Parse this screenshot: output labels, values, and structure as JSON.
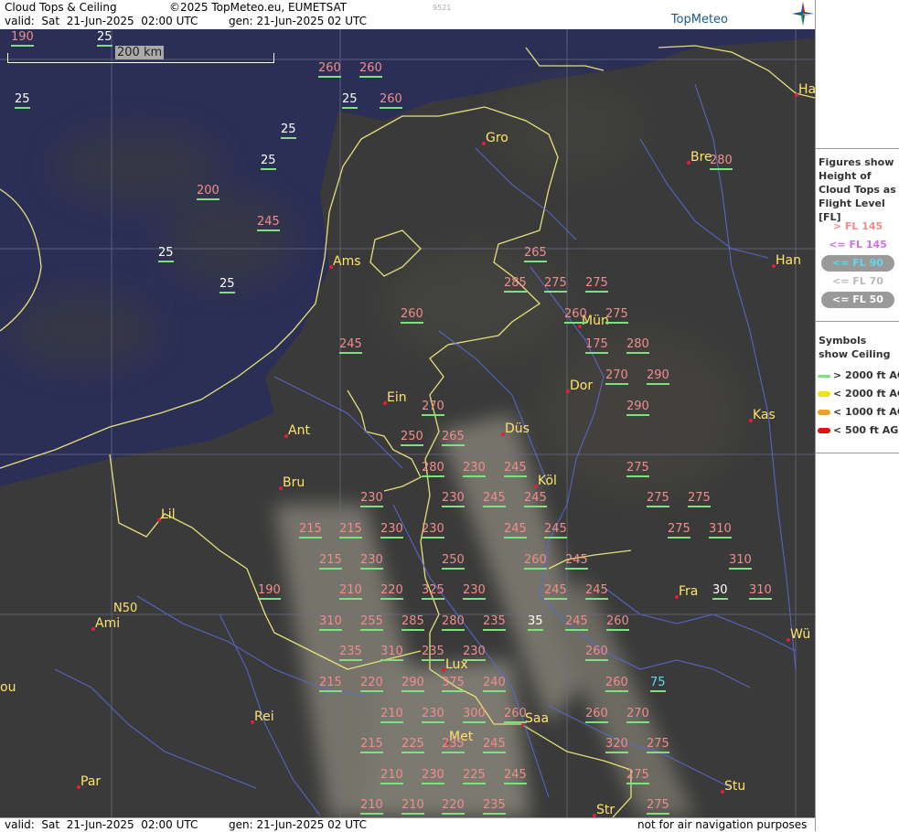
{
  "header": {
    "title": "Cloud Tops & Ceiling",
    "copyright": "©2025 TopMeteo.eu, EUMETSAT",
    "code": "9521",
    "valid": "valid:  Sat  21-Jun-2025  02:00 UTC",
    "gen": "gen: 21-Jun-2025 02 UTC",
    "logo": "TopMeteo"
  },
  "footer": {
    "valid": "valid:  Sat  21-Jun-2025  02:00 UTC",
    "gen": "gen: 21-Jun-2025 02 UTC",
    "disclaimer": "not for air navigation purposes"
  },
  "scale": "200 km",
  "latitude_label": "N50",
  "legend": {
    "title": "Figures show Height of Cloud Tops as Flight Level  [FL]",
    "levels": [
      {
        "label": "> FL 145",
        "color": "#f28c8c"
      },
      {
        "label": "<= FL 145",
        "color": "#d070e0"
      },
      {
        "label": "<= FL 90",
        "color": "#60d8f0"
      },
      {
        "label": "<= FL 70",
        "color": "#bbbbbb"
      },
      {
        "label": "<= FL 50",
        "color": "#ffffff"
      }
    ],
    "symbols_title": "Symbols show Ceiling",
    "symbols": [
      {
        "label": "> 2000 ft AGL",
        "color": "#7fe07f"
      },
      {
        "label": "< 2000 ft AGL",
        "color": "#f0e020"
      },
      {
        "label": "< 1000 ft AGL",
        "color": "#f0a020"
      },
      {
        "label": "< 500 ft AGL",
        "color": "#e01010"
      }
    ]
  },
  "cities": [
    {
      "name": "Gro"
    },
    {
      "name": "Bre"
    },
    {
      "name": "Ha"
    },
    {
      "name": "Ams"
    },
    {
      "name": "Han"
    },
    {
      "name": "Mün"
    },
    {
      "name": "Ein"
    },
    {
      "name": "Dor"
    },
    {
      "name": "Düs"
    },
    {
      "name": "Kas"
    },
    {
      "name": "Ant"
    },
    {
      "name": "Köl"
    },
    {
      "name": "Bru"
    },
    {
      "name": "Lil"
    },
    {
      "name": "Fra"
    },
    {
      "name": "Ami"
    },
    {
      "name": "Wü"
    },
    {
      "name": "Lux"
    },
    {
      "name": "ou"
    },
    {
      "name": "Rei"
    },
    {
      "name": "Saa"
    },
    {
      "name": "Met"
    },
    {
      "name": "Par"
    },
    {
      "name": "Stu"
    },
    {
      "name": "Str"
    }
  ],
  "values": [
    {
      "v": "190",
      "c": "pink"
    },
    {
      "v": "25",
      "c": "white"
    },
    {
      "v": "260",
      "c": "pink"
    },
    {
      "v": "260",
      "c": "pink"
    },
    {
      "v": "25",
      "c": "white"
    },
    {
      "v": "25",
      "c": "white"
    },
    {
      "v": "260",
      "c": "pink"
    },
    {
      "v": "25",
      "c": "white"
    },
    {
      "v": "25",
      "c": "white"
    },
    {
      "v": "280",
      "c": "pink"
    },
    {
      "v": "200",
      "c": "pink"
    },
    {
      "v": "245",
      "c": "pink"
    },
    {
      "v": "25",
      "c": "white"
    },
    {
      "v": "265",
      "c": "pink"
    },
    {
      "v": "25",
      "c": "white"
    },
    {
      "v": "285",
      "c": "pink"
    },
    {
      "v": "275",
      "c": "pink"
    },
    {
      "v": "275",
      "c": "pink"
    },
    {
      "v": "260",
      "c": "pink"
    },
    {
      "v": "260",
      "c": "pink"
    },
    {
      "v": "275",
      "c": "pink"
    },
    {
      "v": "245",
      "c": "pink"
    },
    {
      "v": "175",
      "c": "pink"
    },
    {
      "v": "280",
      "c": "pink"
    },
    {
      "v": "270",
      "c": "pink"
    },
    {
      "v": "290",
      "c": "pink"
    },
    {
      "v": "270",
      "c": "pink"
    },
    {
      "v": "290",
      "c": "pink"
    },
    {
      "v": "250",
      "c": "pink"
    },
    {
      "v": "265",
      "c": "pink"
    },
    {
      "v": "280",
      "c": "pink"
    },
    {
      "v": "230",
      "c": "pink"
    },
    {
      "v": "245",
      "c": "pink"
    },
    {
      "v": "275",
      "c": "pink"
    },
    {
      "v": "230",
      "c": "pink"
    },
    {
      "v": "230",
      "c": "pink"
    },
    {
      "v": "245",
      "c": "pink"
    },
    {
      "v": "245",
      "c": "pink"
    },
    {
      "v": "275",
      "c": "pink"
    },
    {
      "v": "275",
      "c": "pink"
    },
    {
      "v": "215",
      "c": "pink"
    },
    {
      "v": "215",
      "c": "pink"
    },
    {
      "v": "230",
      "c": "pink"
    },
    {
      "v": "230",
      "c": "pink"
    },
    {
      "v": "245",
      "c": "pink"
    },
    {
      "v": "245",
      "c": "pink"
    },
    {
      "v": "275",
      "c": "pink"
    },
    {
      "v": "310",
      "c": "pink"
    },
    {
      "v": "215",
      "c": "pink"
    },
    {
      "v": "230",
      "c": "pink"
    },
    {
      "v": "250",
      "c": "pink"
    },
    {
      "v": "260",
      "c": "pink"
    },
    {
      "v": "245",
      "c": "pink"
    },
    {
      "v": "310",
      "c": "pink"
    },
    {
      "v": "190",
      "c": "pink"
    },
    {
      "v": "210",
      "c": "pink"
    },
    {
      "v": "220",
      "c": "pink"
    },
    {
      "v": "325",
      "c": "pink"
    },
    {
      "v": "230",
      "c": "pink"
    },
    {
      "v": "245",
      "c": "pink"
    },
    {
      "v": "245",
      "c": "pink"
    },
    {
      "v": "30",
      "c": "white"
    },
    {
      "v": "310",
      "c": "pink"
    },
    {
      "v": "310",
      "c": "pink"
    },
    {
      "v": "255",
      "c": "pink"
    },
    {
      "v": "285",
      "c": "pink"
    },
    {
      "v": "280",
      "c": "pink"
    },
    {
      "v": "235",
      "c": "pink"
    },
    {
      "v": "35",
      "c": "white"
    },
    {
      "v": "245",
      "c": "pink"
    },
    {
      "v": "260",
      "c": "pink"
    },
    {
      "v": "235",
      "c": "pink"
    },
    {
      "v": "310",
      "c": "pink"
    },
    {
      "v": "235",
      "c": "pink"
    },
    {
      "v": "230",
      "c": "pink"
    },
    {
      "v": "260",
      "c": "pink"
    },
    {
      "v": "215",
      "c": "pink"
    },
    {
      "v": "220",
      "c": "pink"
    },
    {
      "v": "290",
      "c": "pink"
    },
    {
      "v": "375",
      "c": "pink"
    },
    {
      "v": "240",
      "c": "pink"
    },
    {
      "v": "260",
      "c": "pink"
    },
    {
      "v": "75",
      "c": "cyan"
    },
    {
      "v": "210",
      "c": "pink"
    },
    {
      "v": "230",
      "c": "pink"
    },
    {
      "v": "300",
      "c": "pink"
    },
    {
      "v": "260",
      "c": "pink"
    },
    {
      "v": "260",
      "c": "pink"
    },
    {
      "v": "270",
      "c": "pink"
    },
    {
      "v": "215",
      "c": "pink"
    },
    {
      "v": "225",
      "c": "pink"
    },
    {
      "v": "235",
      "c": "pink"
    },
    {
      "v": "245",
      "c": "pink"
    },
    {
      "v": "320",
      "c": "pink"
    },
    {
      "v": "275",
      "c": "pink"
    },
    {
      "v": "210",
      "c": "pink"
    },
    {
      "v": "230",
      "c": "pink"
    },
    {
      "v": "225",
      "c": "pink"
    },
    {
      "v": "245",
      "c": "pink"
    },
    {
      "v": "275",
      "c": "pink"
    },
    {
      "v": "210",
      "c": "pink"
    },
    {
      "v": "210",
      "c": "pink"
    },
    {
      "v": "220",
      "c": "pink"
    },
    {
      "v": "235",
      "c": "pink"
    },
    {
      "v": "275",
      "c": "pink"
    }
  ]
}
